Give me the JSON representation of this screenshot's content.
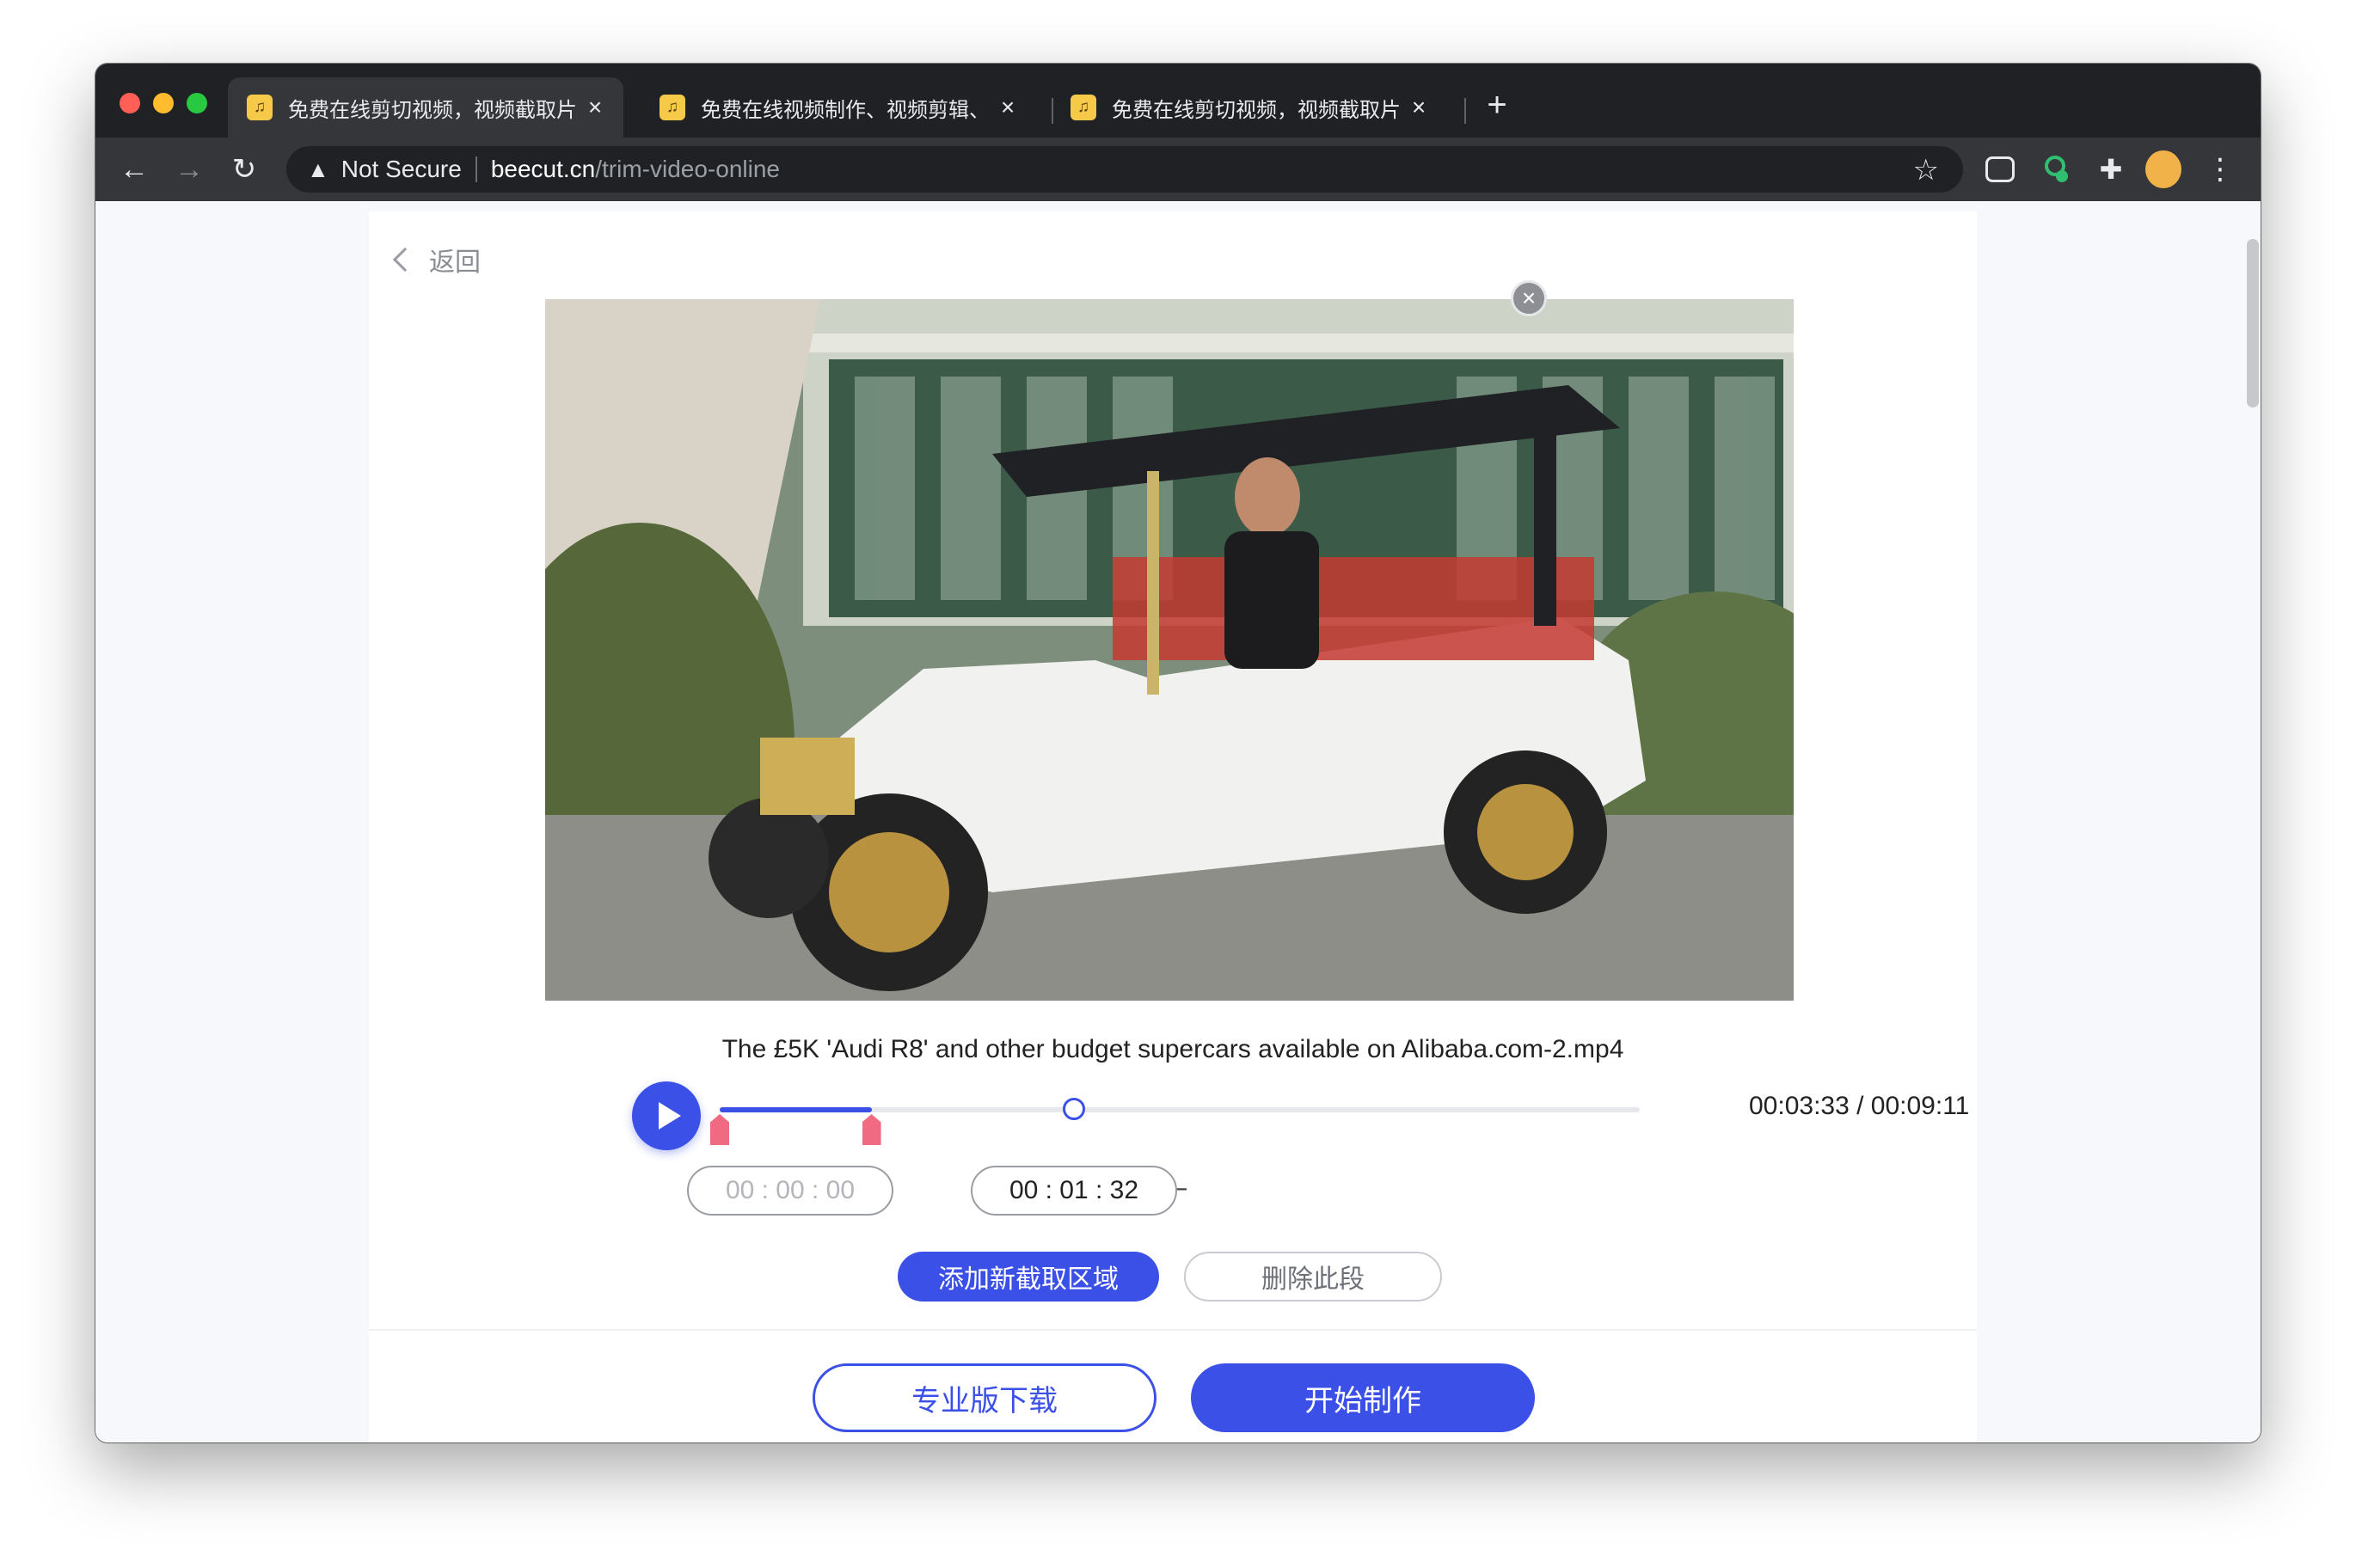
{
  "browser": {
    "tabs": [
      {
        "title": "免费在线剪切视频，视频截取片段",
        "active": true,
        "favicon": "beecut-favicon"
      },
      {
        "title": "免费在线视频制作、视频剪辑、视",
        "active": false,
        "favicon": "beecut-favicon"
      },
      {
        "title": "免费在线剪切视频，视频截取片段",
        "active": false,
        "favicon": "beecut-favicon"
      }
    ],
    "security_label": "Not Secure",
    "url_host": "beecut.cn",
    "url_path": "/trim-video-online"
  },
  "page": {
    "back_label": "返回",
    "video": {
      "filename": "The £5K 'Audi R8' and other budget supercars available on Alibaba.com-2.mp4",
      "time_display": "00:03:33 / 00:09:11",
      "progress_fraction": 0.385,
      "selection_start_fraction": 0.0,
      "selection_end_fraction": 0.165
    },
    "trim": {
      "start_value": "00 : 00 : 00",
      "separator": "—",
      "end_value": "00 : 01 : 32"
    },
    "buttons": {
      "add_region": "添加新截取区域",
      "delete_segment": "删除此段",
      "pro_download": "专业版下载",
      "start": "开始制作"
    }
  },
  "colors": {
    "accent": "#3b50e6",
    "marker": "#f06b82",
    "tab_bar": "#202124",
    "toolbar": "#35363a"
  }
}
